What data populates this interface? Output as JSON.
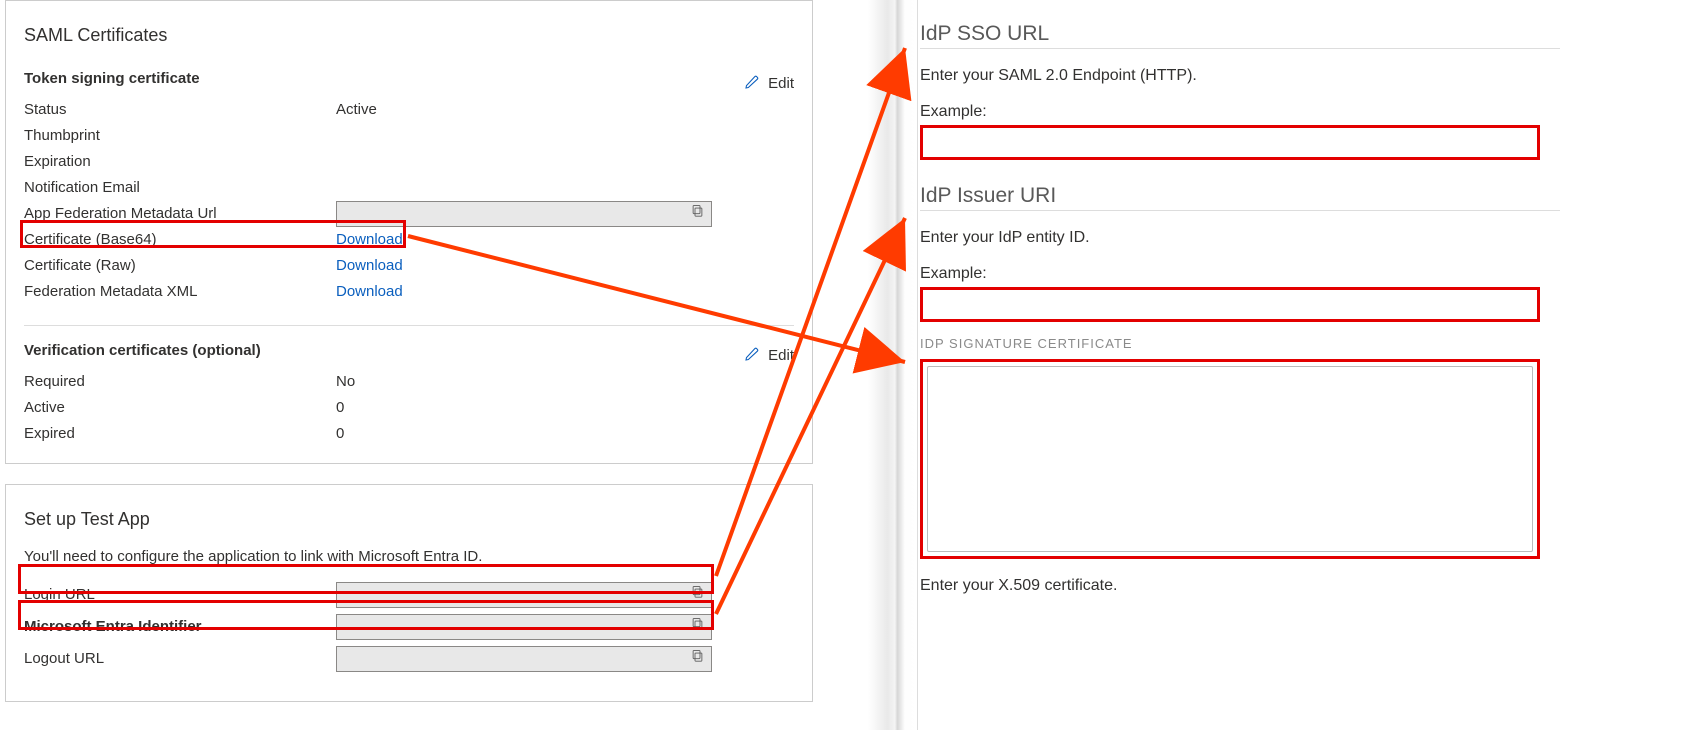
{
  "left": {
    "saml_card": {
      "title": "SAML Certificates",
      "token_section": "Token signing certificate",
      "edit": "Edit",
      "rows": {
        "status": {
          "label": "Status",
          "value": "Active"
        },
        "thumbprint": {
          "label": "Thumbprint"
        },
        "expiration": {
          "label": "Expiration"
        },
        "notification_email": {
          "label": "Notification Email"
        },
        "app_fed_url": {
          "label": "App Federation Metadata Url"
        },
        "cert_b64": {
          "label": "Certificate (Base64)",
          "action": "Download"
        },
        "cert_raw": {
          "label": "Certificate (Raw)",
          "action": "Download"
        },
        "fed_xml": {
          "label": "Federation Metadata XML",
          "action": "Download"
        }
      },
      "verify_section": "Verification certificates (optional)",
      "verify_rows": {
        "required": {
          "label": "Required",
          "value": "No"
        },
        "active": {
          "label": "Active",
          "value": "0"
        },
        "expired": {
          "label": "Expired",
          "value": "0"
        }
      }
    },
    "setup_card": {
      "title": "Set up Test App",
      "note": "You'll need to configure the application to link with Microsoft Entra ID.",
      "rows": {
        "login_url": {
          "label": "Login URL"
        },
        "entra_id": {
          "label": "Microsoft Entra Identifier"
        },
        "logout_url": {
          "label": "Logout URL"
        }
      }
    }
  },
  "right": {
    "sso": {
      "heading": "IdP SSO URL",
      "desc": "Enter your SAML 2.0 Endpoint (HTTP).",
      "example_label": "Example:"
    },
    "issuer": {
      "heading": "IdP Issuer URI",
      "desc": "Enter your IdP entity ID.",
      "example_label": "Example:"
    },
    "sig": {
      "subhead": "IDP SIGNATURE CERTIFICATE",
      "hint": "Enter your X.509 certificate."
    }
  }
}
